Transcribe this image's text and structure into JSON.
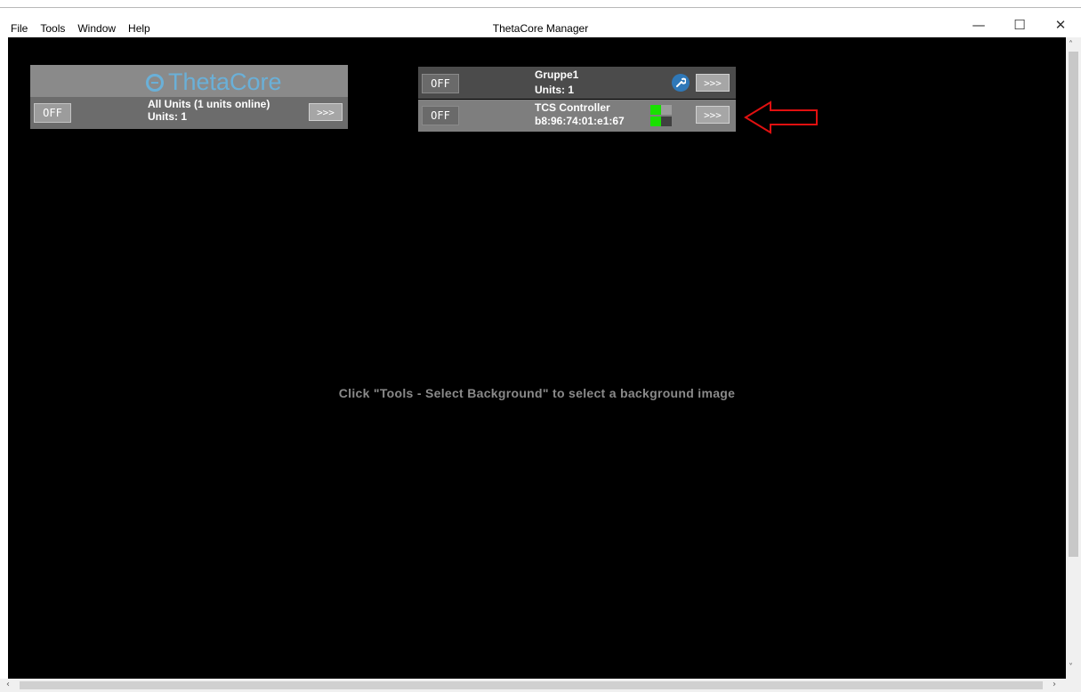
{
  "window": {
    "title": "ThetaCore Manager",
    "minimize": "—",
    "maximize": "☐",
    "close": "✕"
  },
  "menu": [
    "File",
    "Tools",
    "Window",
    "Help"
  ],
  "all_units_panel": {
    "logo_text": "ThetaCore",
    "off_label": "OFF",
    "title": "All Units (1 units online)",
    "units": "Units: 1",
    "open_label": ">>>"
  },
  "group_panel": {
    "off_label": "OFF",
    "name": "Gruppe1",
    "units": "Units: 1",
    "open_label": ">>>",
    "settings_icon": "wrench-icon"
  },
  "unit_panel": {
    "off_label": "OFF",
    "name": "TCS Controller",
    "mac": "b8:96:74:01:e1:67",
    "open_label": ">>>",
    "status_colors": [
      "#19e000",
      "#9c9c9c",
      "#19e000",
      "#404040"
    ]
  },
  "hint": "Click \"Tools - Select Background\" to select a background image",
  "annotation_color": "#e01010"
}
